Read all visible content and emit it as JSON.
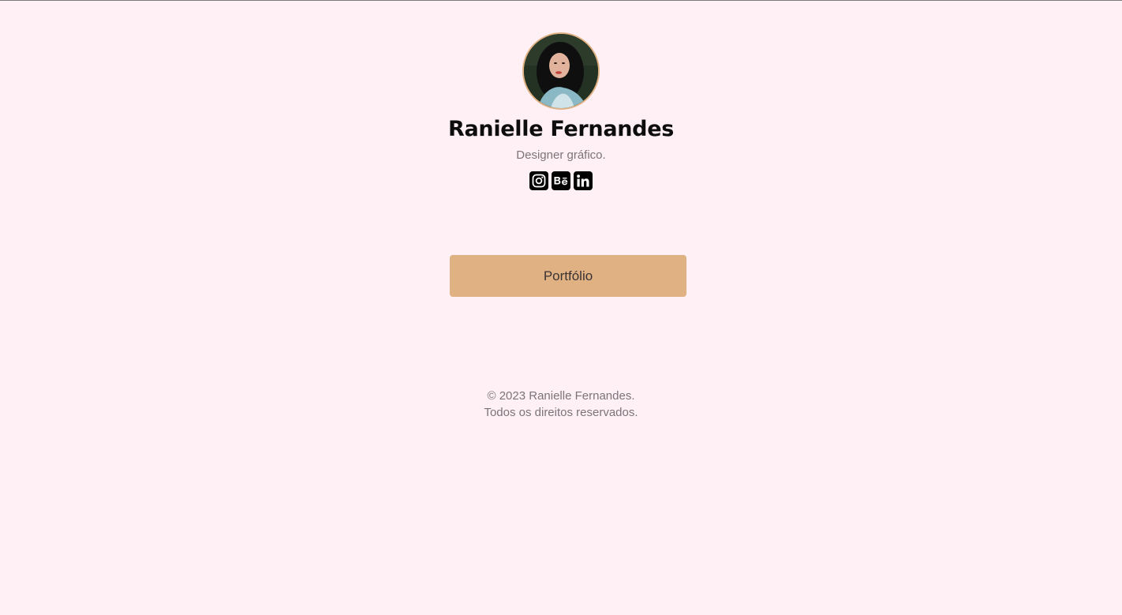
{
  "profile": {
    "name": "Ranielle Fernandes",
    "role": "Designer gráfico."
  },
  "socials": [
    {
      "name": "instagram",
      "icon": "instagram-icon"
    },
    {
      "name": "behance",
      "icon": "behance-icon",
      "glyph": "Bē"
    },
    {
      "name": "linkedin",
      "icon": "linkedin-icon",
      "glyph": "in"
    }
  ],
  "links": {
    "portfolio_label": "Portfólio"
  },
  "footer": {
    "line1": "© 2023 Ranielle Fernandes.",
    "line2": "Todos os direitos reservados."
  },
  "colors": {
    "background": "#fff0f5",
    "accent": "#dfb183",
    "text_dark": "#0d0d0d",
    "text_muted": "#7b7479"
  }
}
